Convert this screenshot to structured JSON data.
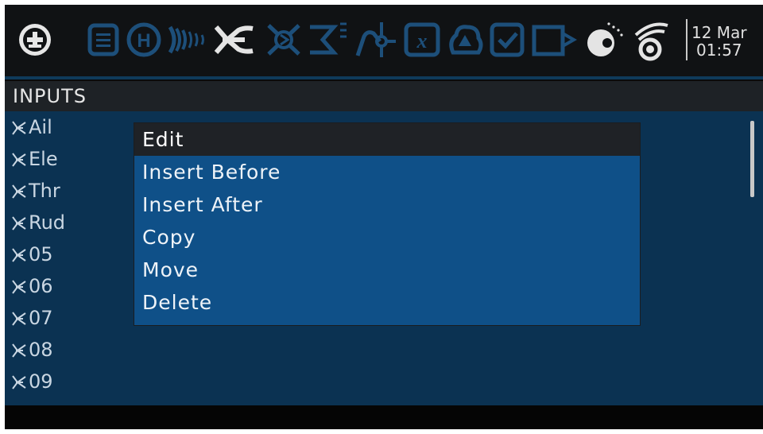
{
  "topbar": {
    "icons": [
      "add-circle-icon",
      "model-list-icon",
      "heli-icon",
      "radio-setup-icon",
      "inputs-icon",
      "mixes-icon",
      "outputs-icon",
      "curves-icon",
      "global-variables-icon",
      "logical-switches-icon",
      "special-functions-icon",
      "checklist-icon",
      "telemetry-icon",
      "display-icon"
    ],
    "date": "12 Mar",
    "time": "01:57"
  },
  "page": {
    "title": "INPUTS"
  },
  "inputs": [
    {
      "label": "Ail"
    },
    {
      "label": "Ele"
    },
    {
      "label": "Thr"
    },
    {
      "label": "Rud"
    },
    {
      "label": "05"
    },
    {
      "label": "06"
    },
    {
      "label": "07"
    },
    {
      "label": "08"
    },
    {
      "label": "09"
    }
  ],
  "context_menu": {
    "items": [
      {
        "label": "Edit",
        "selected": true
      },
      {
        "label": "Insert Before"
      },
      {
        "label": "Insert After"
      },
      {
        "label": "Copy"
      },
      {
        "label": "Move"
      },
      {
        "label": "Delete"
      }
    ]
  },
  "colors": {
    "accent": "#0f5088",
    "list_background": "#0b3252",
    "icon_blue": "#1d4f7a",
    "active_icon": "#e4e4e4"
  }
}
